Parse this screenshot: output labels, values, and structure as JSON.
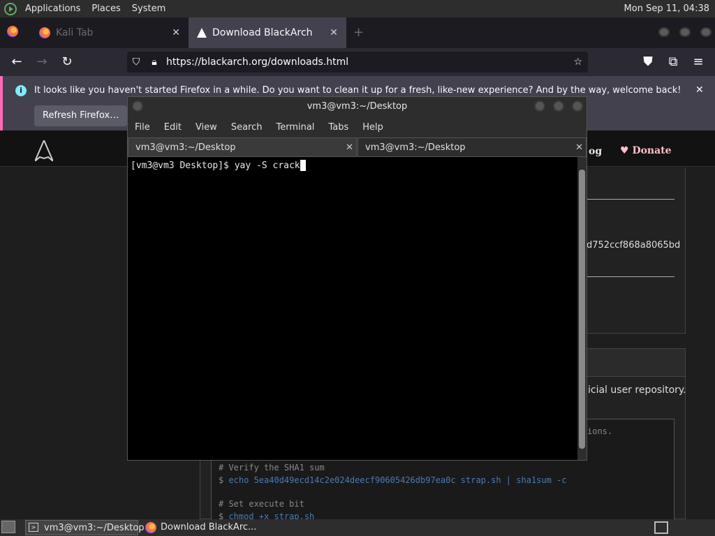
{
  "system_panel": {
    "menus": [
      "Applications",
      "Places",
      "System"
    ],
    "clock": "Mon Sep 11, 04:38"
  },
  "firefox": {
    "tabs": [
      {
        "label": "Kali Tab"
      },
      {
        "label": "Download BlackArch"
      }
    ],
    "url": "https://blackarch.org/downloads.html",
    "notification": {
      "text": "It looks like you haven't started Firefox in a while. Do you want to clean it up for a fresh, like-new experience? And by the way, welcome back!",
      "button": "Refresh Firefox…"
    },
    "page": {
      "nav_blog": "og",
      "nav_donate": "Donate",
      "hash_fragment": "d752ccf868a8065bd",
      "repo_fragment": "icial user repository.",
      "code_fragment": "ions.",
      "code": [
        {
          "comment": "# Verify the SHA1 sum"
        },
        {
          "prompt": "$ ",
          "cmd": "echo 5ea40d49ecd14c2e024deecf90605426db97ea0c strap.sh | sha1sum -c"
        },
        {
          "comment": "# Set execute bit"
        },
        {
          "prompt": "$ ",
          "cmd": "chmod +x strap.sh"
        }
      ]
    }
  },
  "terminal": {
    "title": "vm3@vm3:~/Desktop",
    "menu": [
      "File",
      "Edit",
      "View",
      "Search",
      "Terminal",
      "Tabs",
      "Help"
    ],
    "tabs": [
      "vm3@vm3:~/Desktop",
      "vm3@vm3:~/Desktop"
    ],
    "prompt": "[vm3@vm3 Desktop]$ yay -S crack"
  },
  "taskbar": {
    "items": [
      "vm3@vm3:~/Desktop",
      "Download BlackArc..."
    ]
  }
}
